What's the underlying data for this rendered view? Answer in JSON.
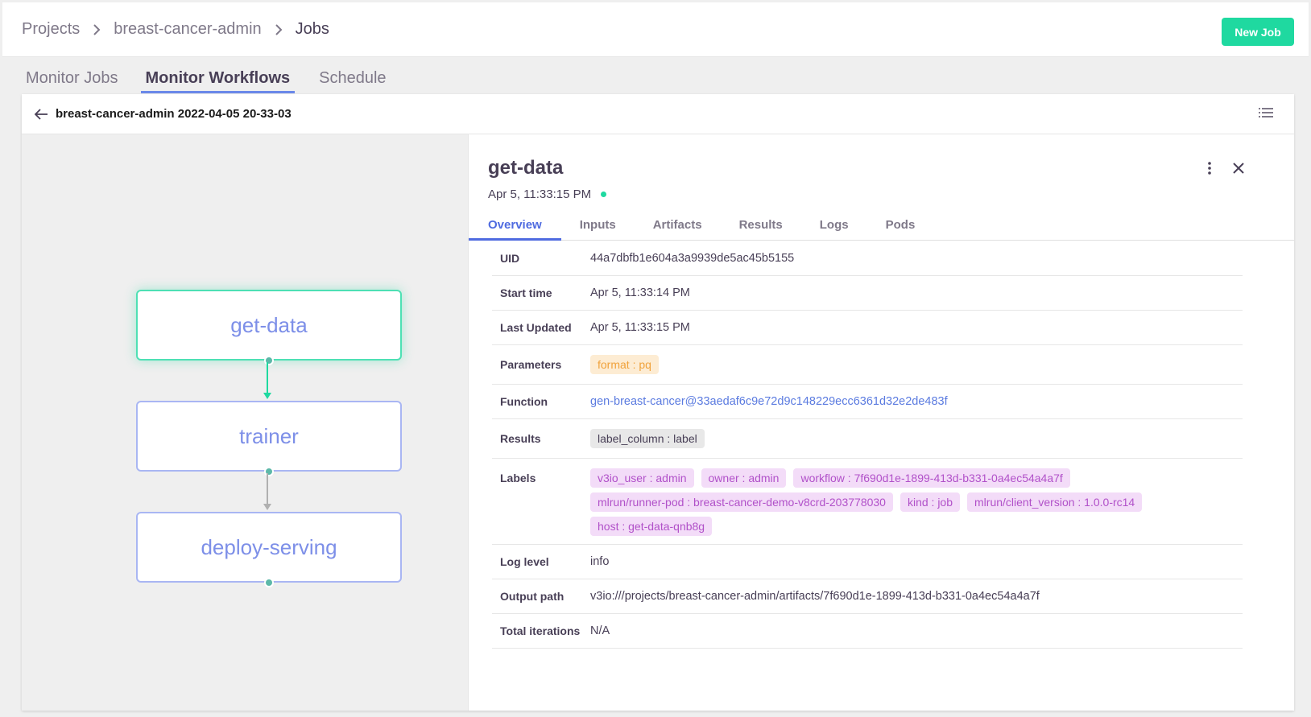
{
  "breadcrumb": {
    "items": [
      "Projects",
      "breast-cancer-admin",
      "Jobs"
    ]
  },
  "header": {
    "new_job_label": "New Job"
  },
  "tabs": [
    "Monitor Jobs",
    "Monitor Workflows",
    "Schedule"
  ],
  "workflow": {
    "title": "breast-cancer-admin 2022-04-05 20-33-03",
    "nodes": [
      "get-data",
      "trainer",
      "deploy-serving"
    ]
  },
  "details": {
    "name": "get-data",
    "date": "Apr 5, 11:33:15 PM",
    "tabs": [
      "Overview",
      "Inputs",
      "Artifacts",
      "Results",
      "Logs",
      "Pods"
    ],
    "rows": {
      "uid": {
        "label": "UID",
        "value": "44a7dbfb1e604a3a9939de5ac45b5155"
      },
      "start_time": {
        "label": "Start time",
        "value": "Apr 5, 11:33:14 PM"
      },
      "last_updated": {
        "label": "Last Updated",
        "value": "Apr 5, 11:33:15 PM"
      },
      "parameters": {
        "label": "Parameters",
        "chips": [
          "format : pq"
        ]
      },
      "function": {
        "label": "Function",
        "value": "gen-breast-cancer@33aedaf6c9e72d9c148229ecc6361d32e2de483f"
      },
      "results": {
        "label": "Results",
        "chips": [
          "label_column : label"
        ]
      },
      "labels": {
        "label": "Labels",
        "chips": [
          "v3io_user : admin",
          "owner : admin",
          "workflow : 7f690d1e-1899-413d-b331-0a4ec54a4a7f",
          "mlrun/runner-pod : breast-cancer-demo-v8crd-203778030",
          "kind : job",
          "mlrun/client_version : 1.0.0-rc14",
          "host : get-data-qnb8g"
        ]
      },
      "log_level": {
        "label": "Log level",
        "value": "info"
      },
      "output_path": {
        "label": "Output path",
        "value": "v3io:///projects/breast-cancer-admin/artifacts/7f690d1e-1899-413d-b331-0a4ec54a4a7f"
      },
      "total_iterations": {
        "label": "Total iterations",
        "value": "N/A"
      }
    }
  },
  "colors": {
    "accent_green": "#1fd9a0",
    "accent_blue": "#4f6be0",
    "node_text": "#7d8fe8"
  }
}
